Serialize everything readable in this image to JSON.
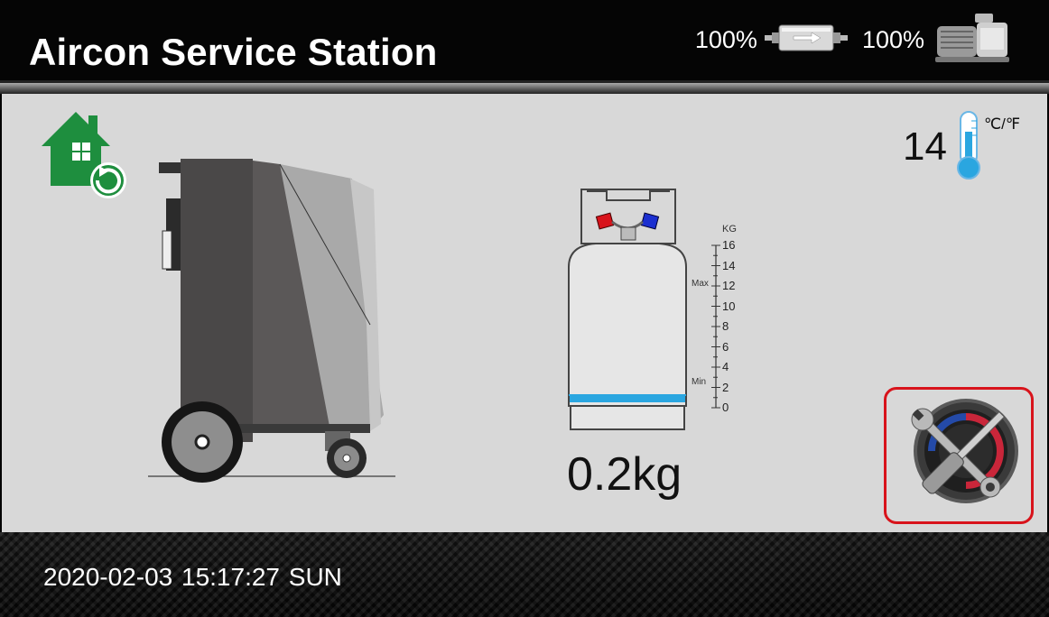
{
  "header": {
    "title": "Aircon Service Station",
    "filter_percent": "100%",
    "pump_percent": "100%"
  },
  "main": {
    "temperature": "14",
    "temperature_unit": "℃/℉",
    "tank_weight": "0.2kg",
    "scale": {
      "unit": "KG",
      "ticks": [
        "16",
        "14",
        "12",
        "10",
        "8",
        "6",
        "4",
        "2",
        "0"
      ],
      "max_label": "Max",
      "min_label": "Min"
    },
    "tank_level_fraction": 0.0125
  },
  "footer": {
    "datetime": "2020-02-03  15:17:27 SUN"
  },
  "icons": {
    "home": "home-refresh-icon",
    "filter": "filter-icon",
    "pump": "vacuum-pump-icon",
    "thermometer": "thermometer-icon",
    "machine": "service-machine-image",
    "tank": "refrigerant-tank-image",
    "tools": "service-tools-icon"
  },
  "colors": {
    "accent_green": "#1e8e3e",
    "highlight_red": "#d8131b",
    "level_blue": "#2aa6e0"
  }
}
